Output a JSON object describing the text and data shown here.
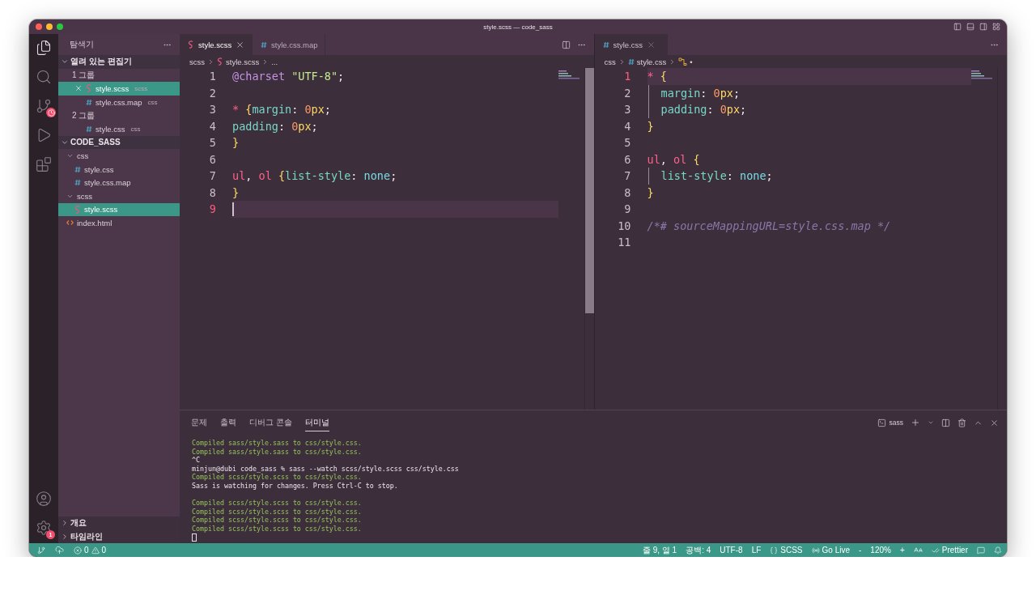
{
  "window": {
    "title": "style.scss — code_sass"
  },
  "activity_bar": {
    "settings_badge": "1"
  },
  "sidebar": {
    "title": "탐색기",
    "open_editors": {
      "title": "열려 있는 편집기",
      "expanded": true,
      "groups": [
        {
          "label": "1 그룹",
          "items": [
            {
              "name": "style.scss",
              "hint": "scss",
              "kind": "scss",
              "selected": true
            },
            {
              "name": "style.css.map",
              "hint": "css",
              "kind": "css",
              "selected": false
            }
          ]
        },
        {
          "label": "2 그룹",
          "items": [
            {
              "name": "style.css",
              "hint": "css",
              "kind": "css",
              "selected": false
            }
          ]
        }
      ]
    },
    "folder": {
      "title": "CODE_SASS",
      "expanded": true,
      "children": [
        {
          "name": "css",
          "kind": "folder",
          "expanded": true,
          "selected": false,
          "children": [
            {
              "name": "style.css",
              "kind": "css",
              "selected": false
            },
            {
              "name": "style.css.map",
              "kind": "css",
              "selected": false
            }
          ]
        },
        {
          "name": "scss",
          "kind": "folder",
          "expanded": true,
          "selected": false,
          "children": [
            {
              "name": "style.scss",
              "kind": "scss",
              "selected": true
            }
          ]
        },
        {
          "name": "index.html",
          "kind": "html",
          "selected": false
        }
      ]
    },
    "bottom_sections": [
      {
        "title": "개요",
        "expanded": false
      },
      {
        "title": "타임라인",
        "expanded": false
      }
    ]
  },
  "editor_groups": [
    {
      "focused": true,
      "tabs": [
        {
          "label": "style.scss",
          "kind": "scss",
          "selected": true
        },
        {
          "label": "style.css.map",
          "kind": "css",
          "selected": false
        }
      ],
      "breadcrumbs": [
        {
          "text": "scss",
          "kind": "folder"
        },
        {
          "text": "style.scss",
          "kind": "scss"
        },
        {
          "text": "...",
          "kind": "folder"
        }
      ],
      "lines": [
        {
          "number": "1",
          "current": false,
          "indent": false,
          "tokens": [
            {
              "text": "@charset",
              "kind": "at"
            },
            {
              "text": " \"UTF-8\"",
              "kind": "string"
            },
            {
              "text": ";",
              "kind": "punct"
            }
          ]
        },
        {
          "number": "2",
          "current": false
        },
        {
          "number": "3",
          "current": false,
          "indent": false,
          "tokens": [
            {
              "text": "*",
              "kind": "selector"
            },
            {
              "text": " {",
              "kind": "brace"
            },
            {
              "text": "margin",
              "kind": "prop"
            },
            {
              "text": ": ",
              "kind": "punct"
            },
            {
              "text": "0",
              "kind": "num"
            },
            {
              "text": "px",
              "kind": "unit"
            },
            {
              "text": ";",
              "kind": "punct"
            }
          ]
        },
        {
          "number": "4",
          "current": false,
          "indent": false,
          "tokens": [
            {
              "text": "padding",
              "kind": "prop"
            },
            {
              "text": ": ",
              "kind": "punct"
            },
            {
              "text": "0",
              "kind": "num"
            },
            {
              "text": "px",
              "kind": "unit"
            },
            {
              "text": ";",
              "kind": "punct"
            }
          ]
        },
        {
          "number": "5",
          "current": false,
          "indent": false,
          "tokens": [
            {
              "text": "}",
              "kind": "brace"
            }
          ]
        },
        {
          "number": "6",
          "current": false
        },
        {
          "number": "7",
          "current": false,
          "indent": false,
          "tokens": [
            {
              "text": "ul",
              "kind": "selector"
            },
            {
              "text": ", ",
              "kind": "punct"
            },
            {
              "text": "ol",
              "kind": "selector"
            },
            {
              "text": " {",
              "kind": "brace"
            },
            {
              "text": "list-style",
              "kind": "prop"
            },
            {
              "text": ": ",
              "kind": "punct"
            },
            {
              "text": "none",
              "kind": "value"
            },
            {
              "text": ";",
              "kind": "punct"
            }
          ]
        },
        {
          "number": "8",
          "current": false,
          "indent": false,
          "tokens": [
            {
              "text": "}",
              "kind": "brace"
            }
          ]
        },
        {
          "number": "9",
          "current": true
        }
      ]
    },
    {
      "focused": false,
      "tabs": [
        {
          "label": "style.css",
          "kind": "css",
          "selected": true
        }
      ],
      "breadcrumbs": [
        {
          "text": "css",
          "kind": "folder"
        },
        {
          "text": "style.css",
          "kind": "css"
        },
        {
          "text": "•",
          "kind": "symbol"
        }
      ],
      "lines": [
        {
          "number": "1",
          "current": true,
          "indent": false,
          "tokens": [
            {
              "text": "*",
              "kind": "selector"
            },
            {
              "text": " {",
              "kind": "brace"
            }
          ]
        },
        {
          "number": "2",
          "current": false,
          "indent": true,
          "tokens": [
            {
              "text": "margin",
              "kind": "prop"
            },
            {
              "text": ": ",
              "kind": "punct"
            },
            {
              "text": "0",
              "kind": "num"
            },
            {
              "text": "px",
              "kind": "unit"
            },
            {
              "text": ";",
              "kind": "punct"
            }
          ]
        },
        {
          "number": "3",
          "current": false,
          "indent": true,
          "tokens": [
            {
              "text": "padding",
              "kind": "prop"
            },
            {
              "text": ": ",
              "kind": "punct"
            },
            {
              "text": "0",
              "kind": "num"
            },
            {
              "text": "px",
              "kind": "unit"
            },
            {
              "text": ";",
              "kind": "punct"
            }
          ]
        },
        {
          "number": "4",
          "current": false,
          "indent": false,
          "tokens": [
            {
              "text": "}",
              "kind": "brace"
            }
          ]
        },
        {
          "number": "5",
          "current": false
        },
        {
          "number": "6",
          "current": false,
          "indent": false,
          "tokens": [
            {
              "text": "ul",
              "kind": "selector"
            },
            {
              "text": ", ",
              "kind": "punct"
            },
            {
              "text": "ol",
              "kind": "selector"
            },
            {
              "text": " {",
              "kind": "brace"
            }
          ]
        },
        {
          "number": "7",
          "current": false,
          "indent": true,
          "tokens": [
            {
              "text": "list-style",
              "kind": "prop"
            },
            {
              "text": ": ",
              "kind": "punct"
            },
            {
              "text": "none",
              "kind": "value"
            },
            {
              "text": ";",
              "kind": "punct"
            }
          ]
        },
        {
          "number": "8",
          "current": false,
          "indent": false,
          "tokens": [
            {
              "text": "}",
              "kind": "brace"
            }
          ]
        },
        {
          "number": "9",
          "current": false
        },
        {
          "number": "10",
          "current": false,
          "indent": false,
          "tokens": [
            {
              "text": "/*# sourceMappingURL=style.css.map */",
              "kind": "comment"
            }
          ]
        },
        {
          "number": "11",
          "current": false
        }
      ]
    }
  ],
  "panel": {
    "tabs": [
      {
        "label": "문제",
        "selected": false
      },
      {
        "label": "출력",
        "selected": false
      },
      {
        "label": "디버그 콘솔",
        "selected": false
      },
      {
        "label": "터미널",
        "selected": true
      }
    ],
    "terminal_name": "sass",
    "lines": [
      {
        "kind": "success",
        "text": "Compiled sass/style.sass to css/style.css."
      },
      {
        "kind": "success",
        "text": "Compiled sass/style.sass to css/style.css."
      },
      {
        "kind": "plain",
        "text": "^C"
      },
      {
        "kind": "plain",
        "text": "minjun@dubi code_sass % sass --watch scss/style.scss css/style.css"
      },
      {
        "kind": "success",
        "text": "Compiled scss/style.scss to css/style.css."
      },
      {
        "kind": "plain",
        "text": "Sass is watching for changes. Press Ctrl-C to stop."
      },
      {
        "kind": "blank"
      },
      {
        "kind": "success",
        "text": "Compiled scss/style.scss to css/style.css."
      },
      {
        "kind": "success",
        "text": "Compiled scss/style.scss to css/style.css."
      },
      {
        "kind": "success",
        "text": "Compiled scss/style.scss to css/style.css."
      },
      {
        "kind": "success",
        "text": "Compiled scss/style.scss to css/style.css."
      },
      {
        "kind": "cursor"
      }
    ]
  },
  "status_bar": {
    "errors": "0",
    "warnings": "0",
    "items": [
      {
        "kind": "text",
        "text": "줄 9, 열 1"
      },
      {
        "kind": "text",
        "text": "공백: 4"
      },
      {
        "kind": "text",
        "text": "UTF-8"
      },
      {
        "kind": "text",
        "text": "LF"
      },
      {
        "kind": "language",
        "text": "SCSS"
      },
      {
        "kind": "live",
        "text": "Go Live"
      },
      {
        "kind": "text",
        "text": "-"
      },
      {
        "kind": "text",
        "text": "120%"
      },
      {
        "kind": "text",
        "text": "+"
      },
      {
        "kind": "font-size"
      },
      {
        "kind": "prettier",
        "text": "Prettier"
      },
      {
        "kind": "feedback"
      },
      {
        "kind": "bell"
      }
    ]
  }
}
